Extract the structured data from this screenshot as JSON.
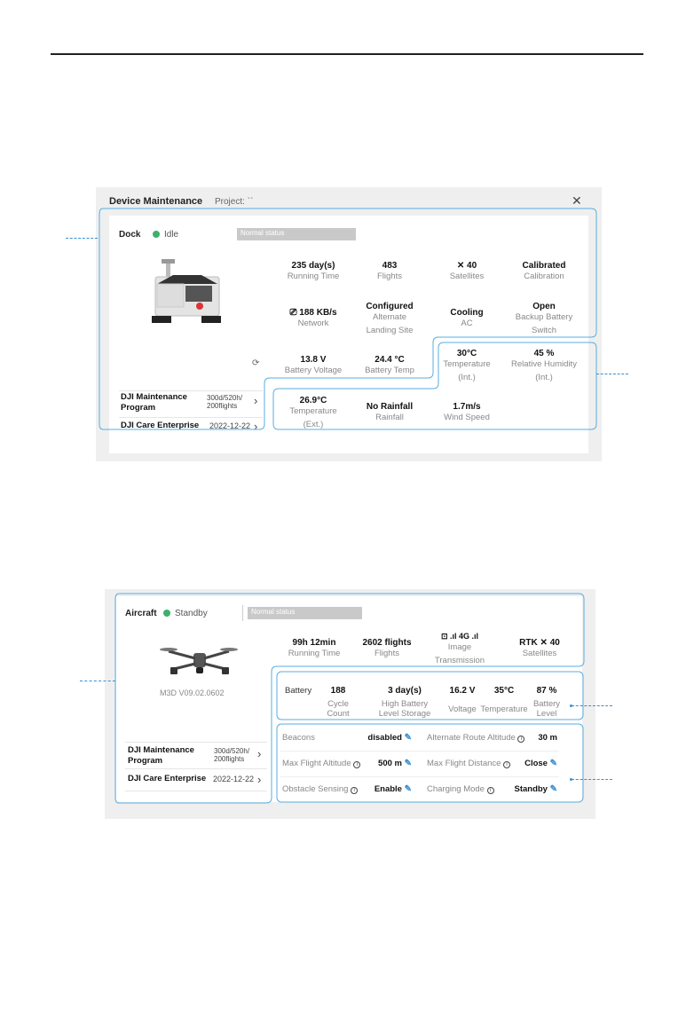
{
  "dock_panel": {
    "title": "Device Maintenance",
    "project_label": "Project: ``",
    "close_glyph": "✕",
    "device_name": "Dock",
    "status": "Idle",
    "status_color": "#3bb16a",
    "normal_status": "Normal status",
    "stats": [
      {
        "value": "235 day(s)",
        "label": "Running Time"
      },
      {
        "value": "483",
        "label": "Flights"
      },
      {
        "value": "40",
        "label": "Satellites",
        "icon": "satellite-icon"
      },
      {
        "value": "Calibrated",
        "label": "Calibration"
      },
      {
        "value": "188 KB/s",
        "label": "Network",
        "icon": "network-icon"
      },
      {
        "value": "Configured",
        "label": "Alternate Landing Site"
      },
      {
        "value": "Cooling",
        "label": "AC"
      },
      {
        "value": "Open",
        "label": "Backup Battery Switch"
      },
      {
        "value": "13.8 V",
        "label": "Battery Voltage"
      },
      {
        "value": "24.4 °C",
        "label": "Battery Temp"
      },
      {
        "value": "30°C",
        "label": "Temperature (Int.)"
      },
      {
        "value": "45 %",
        "label": "Relative Humidity (Int.)"
      },
      {
        "value": "26.9°C",
        "label": "Temperature (Ext.)"
      },
      {
        "value": "No Rainfall",
        "label": "Rainfall"
      },
      {
        "value": "1.7m/s",
        "label": "Wind Speed"
      }
    ],
    "programs": [
      {
        "name": "DJI Maintenance Program",
        "detail": "300d/520h/ 200flights"
      },
      {
        "name": "DJI Care Enterprise",
        "detail": "2022-12-22"
      }
    ]
  },
  "aircraft_panel": {
    "device_name": "Aircraft",
    "status": "Standby",
    "normal_status": "Normal status",
    "model_version": "M3D V09.02.0602",
    "top_stats": [
      {
        "value": "99h 12min",
        "label": "Running Time"
      },
      {
        "value": "2602 flights",
        "label": "Flights"
      },
      {
        "value": ".ıl 4G .ıl",
        "label": "Image Transmission"
      },
      {
        "value": "RTK",
        "value2": "40",
        "label": "Satellites"
      }
    ],
    "battery": {
      "title": "Battery",
      "items": [
        {
          "value": "188",
          "label": "Cycle Count"
        },
        {
          "value": "3 day(s)",
          "label": "High Battery Level Storage"
        },
        {
          "value": "16.2 V",
          "label": "Voltage"
        },
        {
          "value": "35°C",
          "label": "Temperature"
        },
        {
          "value": "87 %",
          "label": "Battery Level"
        }
      ]
    },
    "settings": [
      {
        "label": "Beacons",
        "value": "disabled"
      },
      {
        "label": "Alternate Route Altitude",
        "value": "30 m"
      },
      {
        "label": "Max Flight Altitude",
        "value": "500 m"
      },
      {
        "label": "Max Flight Distance",
        "value": "Close"
      },
      {
        "label": "Obstacle Sensing",
        "value": "Enable"
      },
      {
        "label": "Charging Mode",
        "value": "Standby"
      }
    ],
    "programs": [
      {
        "name": "DJI Maintenance Program",
        "detail": "300d/520h/ 200flights"
      },
      {
        "name": "DJI Care Enterprise",
        "detail": "2022-12-22"
      }
    ]
  },
  "accent_color": "#5aaee0"
}
